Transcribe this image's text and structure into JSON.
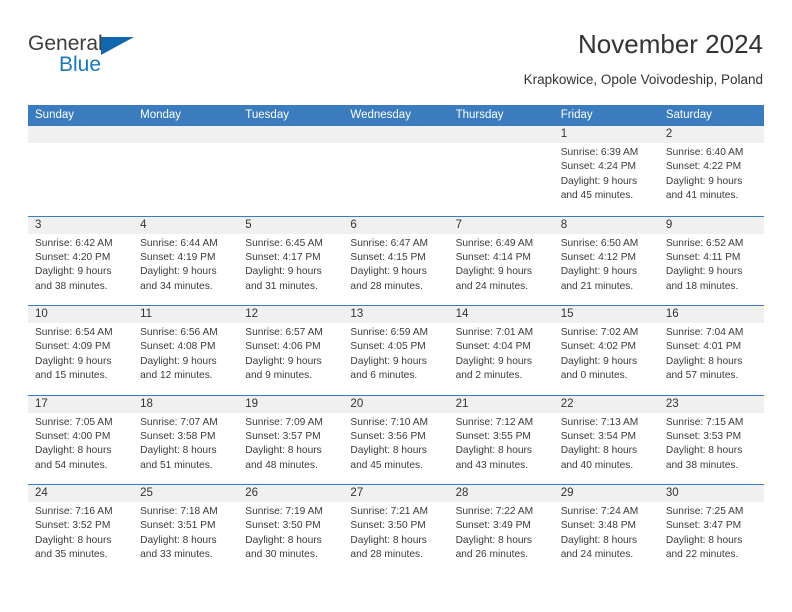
{
  "brand": {
    "line1": "General",
    "line2": "Blue",
    "triangle_color": "#1266ab",
    "blue_color": "#1878be"
  },
  "header": {
    "title": "November 2024",
    "subtitle": "Krapkowice, Opole Voivodeship, Poland"
  },
  "theme": {
    "header_blue": "#3a7cbe",
    "day_band_gray": "#f0f0f0",
    "text": "#333333"
  },
  "weekdays": [
    "Sunday",
    "Monday",
    "Tuesday",
    "Wednesday",
    "Thursday",
    "Friday",
    "Saturday"
  ],
  "weeks": [
    [
      {
        "day": "",
        "empty": true
      },
      {
        "day": "",
        "empty": true
      },
      {
        "day": "",
        "empty": true
      },
      {
        "day": "",
        "empty": true
      },
      {
        "day": "",
        "empty": true
      },
      {
        "day": "1",
        "sunrise": "Sunrise: 6:39 AM",
        "sunset": "Sunset: 4:24 PM",
        "daylight1": "Daylight: 9 hours",
        "daylight2": "and 45 minutes."
      },
      {
        "day": "2",
        "sunrise": "Sunrise: 6:40 AM",
        "sunset": "Sunset: 4:22 PM",
        "daylight1": "Daylight: 9 hours",
        "daylight2": "and 41 minutes."
      }
    ],
    [
      {
        "day": "3",
        "sunrise": "Sunrise: 6:42 AM",
        "sunset": "Sunset: 4:20 PM",
        "daylight1": "Daylight: 9 hours",
        "daylight2": "and 38 minutes."
      },
      {
        "day": "4",
        "sunrise": "Sunrise: 6:44 AM",
        "sunset": "Sunset: 4:19 PM",
        "daylight1": "Daylight: 9 hours",
        "daylight2": "and 34 minutes."
      },
      {
        "day": "5",
        "sunrise": "Sunrise: 6:45 AM",
        "sunset": "Sunset: 4:17 PM",
        "daylight1": "Daylight: 9 hours",
        "daylight2": "and 31 minutes."
      },
      {
        "day": "6",
        "sunrise": "Sunrise: 6:47 AM",
        "sunset": "Sunset: 4:15 PM",
        "daylight1": "Daylight: 9 hours",
        "daylight2": "and 28 minutes."
      },
      {
        "day": "7",
        "sunrise": "Sunrise: 6:49 AM",
        "sunset": "Sunset: 4:14 PM",
        "daylight1": "Daylight: 9 hours",
        "daylight2": "and 24 minutes."
      },
      {
        "day": "8",
        "sunrise": "Sunrise: 6:50 AM",
        "sunset": "Sunset: 4:12 PM",
        "daylight1": "Daylight: 9 hours",
        "daylight2": "and 21 minutes."
      },
      {
        "day": "9",
        "sunrise": "Sunrise: 6:52 AM",
        "sunset": "Sunset: 4:11 PM",
        "daylight1": "Daylight: 9 hours",
        "daylight2": "and 18 minutes."
      }
    ],
    [
      {
        "day": "10",
        "sunrise": "Sunrise: 6:54 AM",
        "sunset": "Sunset: 4:09 PM",
        "daylight1": "Daylight: 9 hours",
        "daylight2": "and 15 minutes."
      },
      {
        "day": "11",
        "sunrise": "Sunrise: 6:56 AM",
        "sunset": "Sunset: 4:08 PM",
        "daylight1": "Daylight: 9 hours",
        "daylight2": "and 12 minutes."
      },
      {
        "day": "12",
        "sunrise": "Sunrise: 6:57 AM",
        "sunset": "Sunset: 4:06 PM",
        "daylight1": "Daylight: 9 hours",
        "daylight2": "and 9 minutes."
      },
      {
        "day": "13",
        "sunrise": "Sunrise: 6:59 AM",
        "sunset": "Sunset: 4:05 PM",
        "daylight1": "Daylight: 9 hours",
        "daylight2": "and 6 minutes."
      },
      {
        "day": "14",
        "sunrise": "Sunrise: 7:01 AM",
        "sunset": "Sunset: 4:04 PM",
        "daylight1": "Daylight: 9 hours",
        "daylight2": "and 2 minutes."
      },
      {
        "day": "15",
        "sunrise": "Sunrise: 7:02 AM",
        "sunset": "Sunset: 4:02 PM",
        "daylight1": "Daylight: 9 hours",
        "daylight2": "and 0 minutes."
      },
      {
        "day": "16",
        "sunrise": "Sunrise: 7:04 AM",
        "sunset": "Sunset: 4:01 PM",
        "daylight1": "Daylight: 8 hours",
        "daylight2": "and 57 minutes."
      }
    ],
    [
      {
        "day": "17",
        "sunrise": "Sunrise: 7:05 AM",
        "sunset": "Sunset: 4:00 PM",
        "daylight1": "Daylight: 8 hours",
        "daylight2": "and 54 minutes."
      },
      {
        "day": "18",
        "sunrise": "Sunrise: 7:07 AM",
        "sunset": "Sunset: 3:58 PM",
        "daylight1": "Daylight: 8 hours",
        "daylight2": "and 51 minutes."
      },
      {
        "day": "19",
        "sunrise": "Sunrise: 7:09 AM",
        "sunset": "Sunset: 3:57 PM",
        "daylight1": "Daylight: 8 hours",
        "daylight2": "and 48 minutes."
      },
      {
        "day": "20",
        "sunrise": "Sunrise: 7:10 AM",
        "sunset": "Sunset: 3:56 PM",
        "daylight1": "Daylight: 8 hours",
        "daylight2": "and 45 minutes."
      },
      {
        "day": "21",
        "sunrise": "Sunrise: 7:12 AM",
        "sunset": "Sunset: 3:55 PM",
        "daylight1": "Daylight: 8 hours",
        "daylight2": "and 43 minutes."
      },
      {
        "day": "22",
        "sunrise": "Sunrise: 7:13 AM",
        "sunset": "Sunset: 3:54 PM",
        "daylight1": "Daylight: 8 hours",
        "daylight2": "and 40 minutes."
      },
      {
        "day": "23",
        "sunrise": "Sunrise: 7:15 AM",
        "sunset": "Sunset: 3:53 PM",
        "daylight1": "Daylight: 8 hours",
        "daylight2": "and 38 minutes."
      }
    ],
    [
      {
        "day": "24",
        "sunrise": "Sunrise: 7:16 AM",
        "sunset": "Sunset: 3:52 PM",
        "daylight1": "Daylight: 8 hours",
        "daylight2": "and 35 minutes."
      },
      {
        "day": "25",
        "sunrise": "Sunrise: 7:18 AM",
        "sunset": "Sunset: 3:51 PM",
        "daylight1": "Daylight: 8 hours",
        "daylight2": "and 33 minutes."
      },
      {
        "day": "26",
        "sunrise": "Sunrise: 7:19 AM",
        "sunset": "Sunset: 3:50 PM",
        "daylight1": "Daylight: 8 hours",
        "daylight2": "and 30 minutes."
      },
      {
        "day": "27",
        "sunrise": "Sunrise: 7:21 AM",
        "sunset": "Sunset: 3:50 PM",
        "daylight1": "Daylight: 8 hours",
        "daylight2": "and 28 minutes."
      },
      {
        "day": "28",
        "sunrise": "Sunrise: 7:22 AM",
        "sunset": "Sunset: 3:49 PM",
        "daylight1": "Daylight: 8 hours",
        "daylight2": "and 26 minutes."
      },
      {
        "day": "29",
        "sunrise": "Sunrise: 7:24 AM",
        "sunset": "Sunset: 3:48 PM",
        "daylight1": "Daylight: 8 hours",
        "daylight2": "and 24 minutes."
      },
      {
        "day": "30",
        "sunrise": "Sunrise: 7:25 AM",
        "sunset": "Sunset: 3:47 PM",
        "daylight1": "Daylight: 8 hours",
        "daylight2": "and 22 minutes."
      }
    ]
  ]
}
